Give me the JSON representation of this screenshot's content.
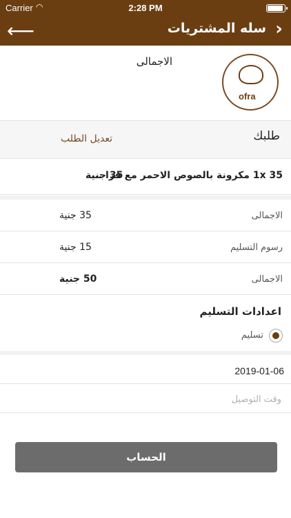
{
  "status_bar": {
    "carrier": "Carrier",
    "time": "2:28 PM"
  },
  "nav": {
    "title": "سله المشتريات"
  },
  "header": {
    "total_label": "الاجمالى",
    "logo_text": "ofra"
  },
  "order": {
    "section_label": "طلبك",
    "edit_label": "تعديل الطلب"
  },
  "item": {
    "text": "35 1x مكرونة بالصوص الاحمر مع فرا ...",
    "price": "35 جنية"
  },
  "summary": {
    "subtotal_label": "الاجمالى",
    "subtotal_value": "35 جنية",
    "delivery_label": "رسوم التسليم",
    "delivery_value": "15 جنية",
    "total_label": "الاجمالى",
    "total_value": "50 جنية"
  },
  "delivery_settings": {
    "title": "اعدادات التسليم",
    "option_label": "تسليم"
  },
  "date": {
    "value": "2019-01-06"
  },
  "delivery_time": {
    "placeholder": "وقت التوصيل"
  },
  "checkout": {
    "label": "الحساب"
  },
  "colors": {
    "brand": "#6b3e12",
    "button": "#6c6c6c"
  }
}
